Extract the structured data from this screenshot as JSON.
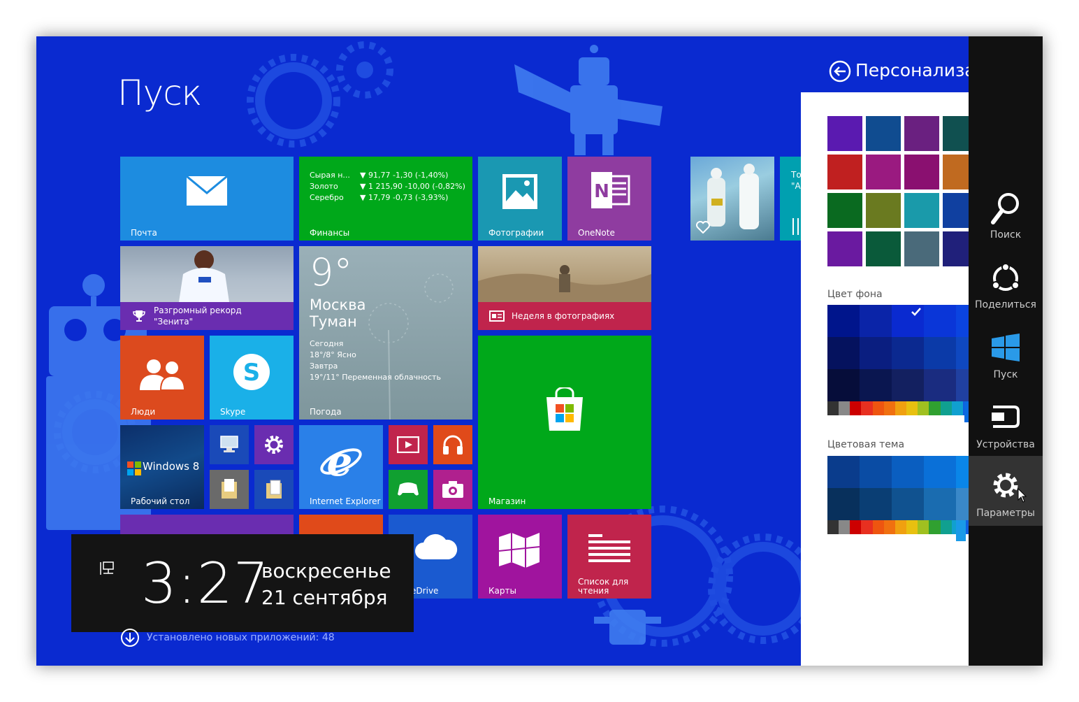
{
  "start_title": "Пуск",
  "tiles": {
    "mail": {
      "name": "Почта"
    },
    "finance": {
      "name": "Финансы",
      "rows": [
        {
          "label": "Сырая н...",
          "value": "▼ 91,77 -1,30 (-1,40%)"
        },
        {
          "label": "Золото",
          "value": "▼ 1 215,90 -10,00 (-0,82%)"
        },
        {
          "label": "Серебро",
          "value": "▼ 17,79 -0,73 (-3,93%)"
        }
      ]
    },
    "photos": {
      "name": "Фотографии"
    },
    "onenote": {
      "name": "OneNote"
    },
    "sport": {
      "headline": "Разгромный рекорд \"Зенита\""
    },
    "weather": {
      "name": "Погода",
      "temp": "9°",
      "city": "Москва",
      "condition": "Туман",
      "today_label": "Сегодня",
      "today": "18°/8° Ясно",
      "tomorrow_label": "Завтра",
      "tomorrow": "19°/11° Переменная облачность"
    },
    "photo_week": {
      "headline": "Неделя в фотографиях"
    },
    "people": {
      "name": "Люди"
    },
    "skype": {
      "name": "Skype"
    },
    "store": {
      "name": "Магазин"
    },
    "desktop": {
      "name": "Рабочий стол",
      "brand": "Windows 8"
    },
    "ie": {
      "name": "Internet Explorer"
    },
    "onedrive": {
      "name": "OneDrive"
    },
    "maps": {
      "name": "Карты"
    },
    "reading": {
      "name": "Список для чтения"
    },
    "partial_text": "То \"А"
  },
  "clock": {
    "time": "3:27",
    "weekday": "воскресенье",
    "date": "21 сентября"
  },
  "installed_notice": "Установлено новых приложений: 48",
  "panel": {
    "title": "Персонализа",
    "background_color_label": "Цвет фона",
    "color_theme_label": "Цветовая тема"
  },
  "charms": [
    {
      "label": "Поиск",
      "icon": "search-icon"
    },
    {
      "label": "Поделиться",
      "icon": "share-icon"
    },
    {
      "label": "Пуск",
      "icon": "windows-icon"
    },
    {
      "label": "Устройства",
      "icon": "devices-icon"
    },
    {
      "label": "Параметры",
      "icon": "settings-icon",
      "active": true
    }
  ],
  "colors": {
    "background": "#0a2ad0",
    "blue_tile": "#1d8ce0",
    "green_tile": "#00a81a",
    "teal_tile": "#1a98b2",
    "purple_tile": "#8f3ca0",
    "orange_tile": "#dc4a1e",
    "cyan_tile": "#1ab0e8",
    "magenta_tile": "#a0149e",
    "crimson_tile": "#b01a48",
    "charms_bar": "#111111"
  },
  "background_grid_colors": [
    "#00158c",
    "#0a24a8",
    "#0a2ad0",
    "#0a36d8",
    "#0b44e0",
    "#05125e",
    "#0a1e80",
    "#0b2990",
    "#0b3aa8",
    "#0f48c0",
    "#060d3a",
    "#0a1650",
    "#132060",
    "#1a2c80",
    "#2040a0"
  ],
  "accent_strip_colors": [
    "#333333",
    "#888888",
    "#cc0000",
    "#e83020",
    "#ee5510",
    "#f07010",
    "#f0a010",
    "#e8c010",
    "#a0c020",
    "#30a030",
    "#10a090",
    "#10a0d0",
    "#1060e0"
  ],
  "theme_grid_colors": [
    "#0a3c8c",
    "#0a4ca4",
    "#0a5ec0",
    "#0a70d8",
    "#0a86e8",
    "#3aa0f0",
    "#08305c",
    "#0a3e74",
    "#105290",
    "#1a6cb0",
    "#3a88c8",
    "#6aaade"
  ],
  "wallpaper_thumbs": [
    "#5a1ab0",
    "#104c90",
    "#6a2080",
    "#105050",
    "#c02020",
    "#9a1a80",
    "#8a1070",
    "#c06a20",
    "#0a6a20",
    "#6a7a20",
    "#1a9aaa",
    "#1040a0",
    "#6a1aa0",
    "#0a5a3a",
    "#4a6a7a",
    "#20207a"
  ]
}
